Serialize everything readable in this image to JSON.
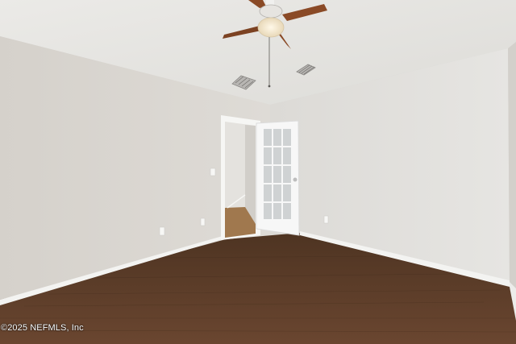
{
  "photo": {
    "watermark": "©2025 NEFMLS, Inc"
  },
  "colors": {
    "ceiling": "#e8e7e4",
    "left_wall": "#d9d6d1",
    "right_wall": "#e2e0dc",
    "back_wall": "#d4d1cc",
    "floor": "#5a3b26",
    "baseboard": "#f4f4f2",
    "fan_blade": "#8a4a26",
    "door": "#f7f7f7"
  }
}
